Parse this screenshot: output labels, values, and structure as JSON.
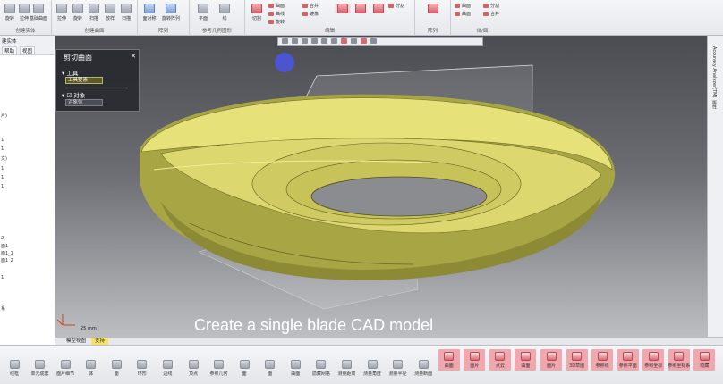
{
  "ribbon": {
    "row1": [
      "旋转",
      "拉伸",
      "旋转",
      "基础曲面",
      "拉伸",
      "旋转",
      "扫描",
      "放样",
      "扫描",
      "基础曲面",
      "面对称",
      "旋转阵列"
    ],
    "mini": [
      "平面",
      "线",
      "平面",
      "切割",
      "曲面",
      "曲线",
      "旋转",
      "合并",
      "镜像",
      "分割",
      "曲面"
    ],
    "groups": [
      "创建实体",
      "创建曲面",
      "阵列",
      "参考几何图形",
      "编辑",
      "阵列",
      "体/面"
    ]
  },
  "tree": {
    "title": "建实体",
    "tabs": [
      "帮助",
      "视图"
    ],
    "items": [
      "片)",
      "1",
      "1",
      "文)",
      "1",
      "1",
      "1",
      "2",
      "面1",
      "面1_1",
      "面1_2",
      "1",
      "系"
    ]
  },
  "viewport": {
    "panel": {
      "title": "剪切曲面",
      "section_tool": "工具",
      "tool_field": "工具要素",
      "section_object": "对象",
      "object_field": "对象体"
    },
    "caption": "Create a single blade CAD model",
    "scale": "25 mm"
  },
  "vscroll": {
    "labels": [
      "Accuracy Analyzer(TM)",
      "属性"
    ]
  },
  "tabbar": {
    "tabs": [
      "模型视图",
      "支持"
    ]
  },
  "bottom": {
    "buttons": [
      "线框",
      "单元成套",
      "面片细节",
      "体",
      "面",
      "环形",
      "边线",
      "顶点",
      "参照几何",
      "面",
      "面",
      "曲面",
      "隐藏网格",
      "测量距离",
      "测量角度",
      "测量半径",
      "测量断面",
      "曲面",
      "面片",
      "点云",
      "曲面",
      "面片",
      "3D草图",
      "参照线",
      "参照平面",
      "参照坐标",
      "参照坐标系",
      "隐藏"
    ],
    "red_from": 17
  },
  "colors": {
    "accent": "#d86a72",
    "active_tab": "#f7e16a",
    "model": "#d9d66a"
  }
}
